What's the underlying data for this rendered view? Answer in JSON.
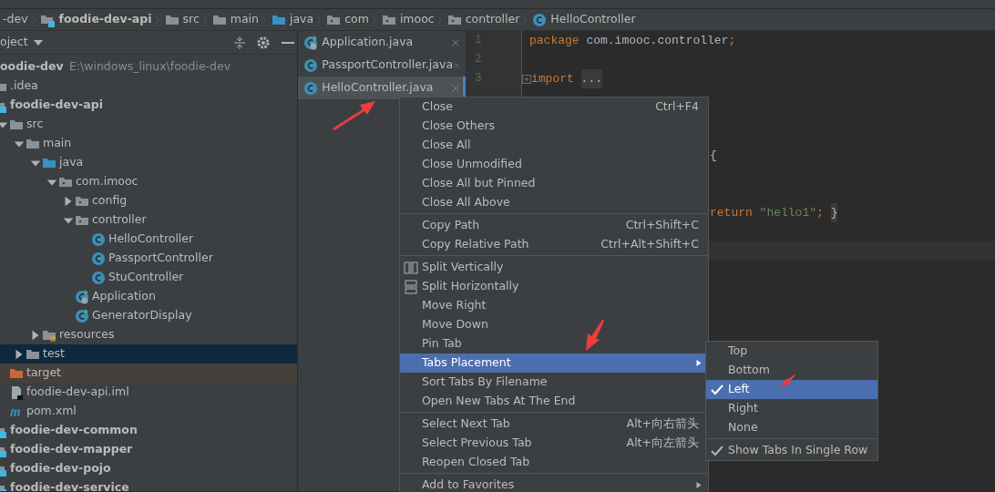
{
  "breadcrumb": [
    {
      "label": "-dev",
      "kind": "text"
    },
    {
      "label": "foodie-dev-api",
      "kind": "module"
    },
    {
      "label": "src",
      "kind": "folder"
    },
    {
      "label": "main",
      "kind": "folder"
    },
    {
      "label": "java",
      "kind": "source-folder"
    },
    {
      "label": "com",
      "kind": "package"
    },
    {
      "label": "imooc",
      "kind": "package"
    },
    {
      "label": "controller",
      "kind": "package"
    },
    {
      "label": "HelloController",
      "kind": "class"
    }
  ],
  "project_panel": {
    "title": "oject",
    "tree": [
      {
        "label": "oodie-dev",
        "path": "E:\\windows_linux\\foodie-dev",
        "kind": "project",
        "selected": false,
        "children": [
          {
            "label": ".idea",
            "kind": "folder",
            "selected": false
          },
          {
            "label": "foodie-dev-api",
            "kind": "module",
            "selected": false,
            "children": [
              {
                "label": "src",
                "kind": "folder",
                "expanded": true,
                "selected": false,
                "children": [
                  {
                    "label": "main",
                    "kind": "folder",
                    "expanded": true,
                    "selected": false,
                    "children": [
                      {
                        "label": "java",
                        "kind": "source-folder",
                        "expanded": true,
                        "selected": false,
                        "children": [
                          {
                            "label": "com.imooc",
                            "kind": "package",
                            "expanded": true,
                            "selected": false,
                            "children": [
                              {
                                "label": "config",
                                "kind": "package",
                                "expanded": false,
                                "selected": false
                              },
                              {
                                "label": "controller",
                                "kind": "package",
                                "expanded": true,
                                "selected": false,
                                "children": [
                                  {
                                    "label": "HelloController",
                                    "kind": "class",
                                    "selected": false
                                  },
                                  {
                                    "label": "PassportController",
                                    "kind": "class",
                                    "selected": false
                                  },
                                  {
                                    "label": "StuController",
                                    "kind": "class",
                                    "selected": false
                                  }
                                ]
                              },
                              {
                                "label": "Application",
                                "kind": "app-class",
                                "selected": false
                              },
                              {
                                "label": "GeneratorDisplay",
                                "kind": "run-class",
                                "selected": false
                              }
                            ]
                          }
                        ]
                      },
                      {
                        "label": "resources",
                        "kind": "resources",
                        "expanded": false,
                        "selected": false
                      }
                    ]
                  },
                  {
                    "label": "test",
                    "kind": "folder",
                    "expanded": false,
                    "selected": true
                  }
                ]
              },
              {
                "label": "target",
                "kind": "excluded-folder",
                "selected": false
              },
              {
                "label": "foodie-dev-api.iml",
                "kind": "iml",
                "selected": false
              },
              {
                "label": "pom.xml",
                "kind": "maven",
                "selected": false
              }
            ]
          },
          {
            "label": "foodie-dev-common",
            "kind": "module",
            "selected": false
          },
          {
            "label": "foodie-dev-mapper",
            "kind": "module",
            "selected": false
          },
          {
            "label": "foodie-dev-pojo",
            "kind": "module",
            "selected": false
          },
          {
            "label": "foodie-dev-service",
            "kind": "module",
            "selected": false
          }
        ]
      }
    ]
  },
  "editor_tabs": [
    {
      "label": "Application.java",
      "kind": "app-class",
      "selected": false
    },
    {
      "label": "PassportController.java",
      "kind": "class",
      "selected": false
    },
    {
      "label": "HelloController.java",
      "kind": "class",
      "selected": true
    }
  ],
  "editor": {
    "line_numbers": [
      "1",
      "2",
      "3"
    ],
    "lines": [
      {
        "kind": "code",
        "segments": [
          {
            "kind": "keyword",
            "text": "package"
          },
          {
            "kind": "plain",
            "text": " com.imooc.controller"
          },
          {
            "kind": "keyword",
            "text": ";"
          }
        ]
      },
      {
        "kind": "blank"
      },
      {
        "kind": "fold",
        "segments": [
          {
            "kind": "keyword",
            "text": "import"
          },
          {
            "kind": "fold",
            "text": "..."
          }
        ]
      },
      {
        "kind": "blank"
      },
      {
        "kind": "blank"
      },
      {
        "kind": "blank"
      },
      {
        "kind": "tail",
        "segments": [
          {
            "kind": "plain",
            "text": "{"
          }
        ]
      },
      {
        "kind": "blank"
      },
      {
        "kind": "blank"
      },
      {
        "kind": "tail",
        "segments": [
          {
            "kind": "keyword",
            "text": "return"
          },
          {
            "kind": "string",
            "text": "\"hello1\""
          },
          {
            "kind": "keyword",
            "text": ";"
          },
          {
            "kind": "fold",
            "text": "}"
          }
        ]
      },
      {
        "kind": "blank"
      },
      {
        "kind": "caret-line"
      }
    ]
  },
  "context_menu": [
    {
      "kind": "item",
      "label": "Close",
      "shortcut": "Ctrl+F4",
      "selected": false
    },
    {
      "kind": "item",
      "label": "Close Others",
      "selected": false
    },
    {
      "kind": "item",
      "label": "Close All",
      "selected": false
    },
    {
      "kind": "item",
      "label": "Close Unmodified",
      "selected": false
    },
    {
      "kind": "item",
      "label": "Close All but Pinned",
      "selected": false
    },
    {
      "kind": "item",
      "label": "Close All Above",
      "selected": false
    },
    {
      "kind": "separator"
    },
    {
      "kind": "item",
      "label": "Copy Path",
      "shortcut": "Ctrl+Shift+C",
      "selected": false
    },
    {
      "kind": "item",
      "label": "Copy Relative Path",
      "shortcut": "Ctrl+Alt+Shift+C",
      "selected": false
    },
    {
      "kind": "separator"
    },
    {
      "kind": "split-vertical",
      "label": "Split Vertically",
      "selected": false
    },
    {
      "kind": "split-horizontal",
      "label": "Split Horizontally",
      "selected": false
    },
    {
      "kind": "item",
      "label": "Move Right",
      "selected": false
    },
    {
      "kind": "item",
      "label": "Move Down",
      "selected": false
    },
    {
      "kind": "item",
      "label": "Pin Tab",
      "selected": false
    },
    {
      "kind": "submenu",
      "label": "Tabs Placement",
      "selected": true
    },
    {
      "kind": "item",
      "label": "Sort Tabs By Filename",
      "selected": false
    },
    {
      "kind": "item",
      "label": "Open New Tabs At The End",
      "selected": false
    },
    {
      "kind": "separator"
    },
    {
      "kind": "item",
      "label": "Select Next Tab",
      "shortcut": "Alt+向右箭头",
      "selected": false
    },
    {
      "kind": "item",
      "label": "Select Previous Tab",
      "shortcut": "Alt+向左箭头",
      "selected": false
    },
    {
      "kind": "item",
      "label": "Reopen Closed Tab",
      "selected": false
    },
    {
      "kind": "separator"
    },
    {
      "kind": "submenu",
      "label": "Add to Favorites",
      "selected": false
    }
  ],
  "submenu": [
    {
      "kind": "item",
      "label": "Top",
      "checked": false,
      "selected": false
    },
    {
      "kind": "item",
      "label": "Bottom",
      "checked": false,
      "selected": false
    },
    {
      "kind": "item",
      "label": "Left",
      "checked": true,
      "selected": true
    },
    {
      "kind": "item",
      "label": "Right",
      "checked": false,
      "selected": false
    },
    {
      "kind": "item",
      "label": "None",
      "checked": false,
      "selected": false
    },
    {
      "kind": "separator"
    },
    {
      "kind": "item",
      "label": "Show Tabs In Single Row",
      "checked": true,
      "selected": false
    }
  ]
}
